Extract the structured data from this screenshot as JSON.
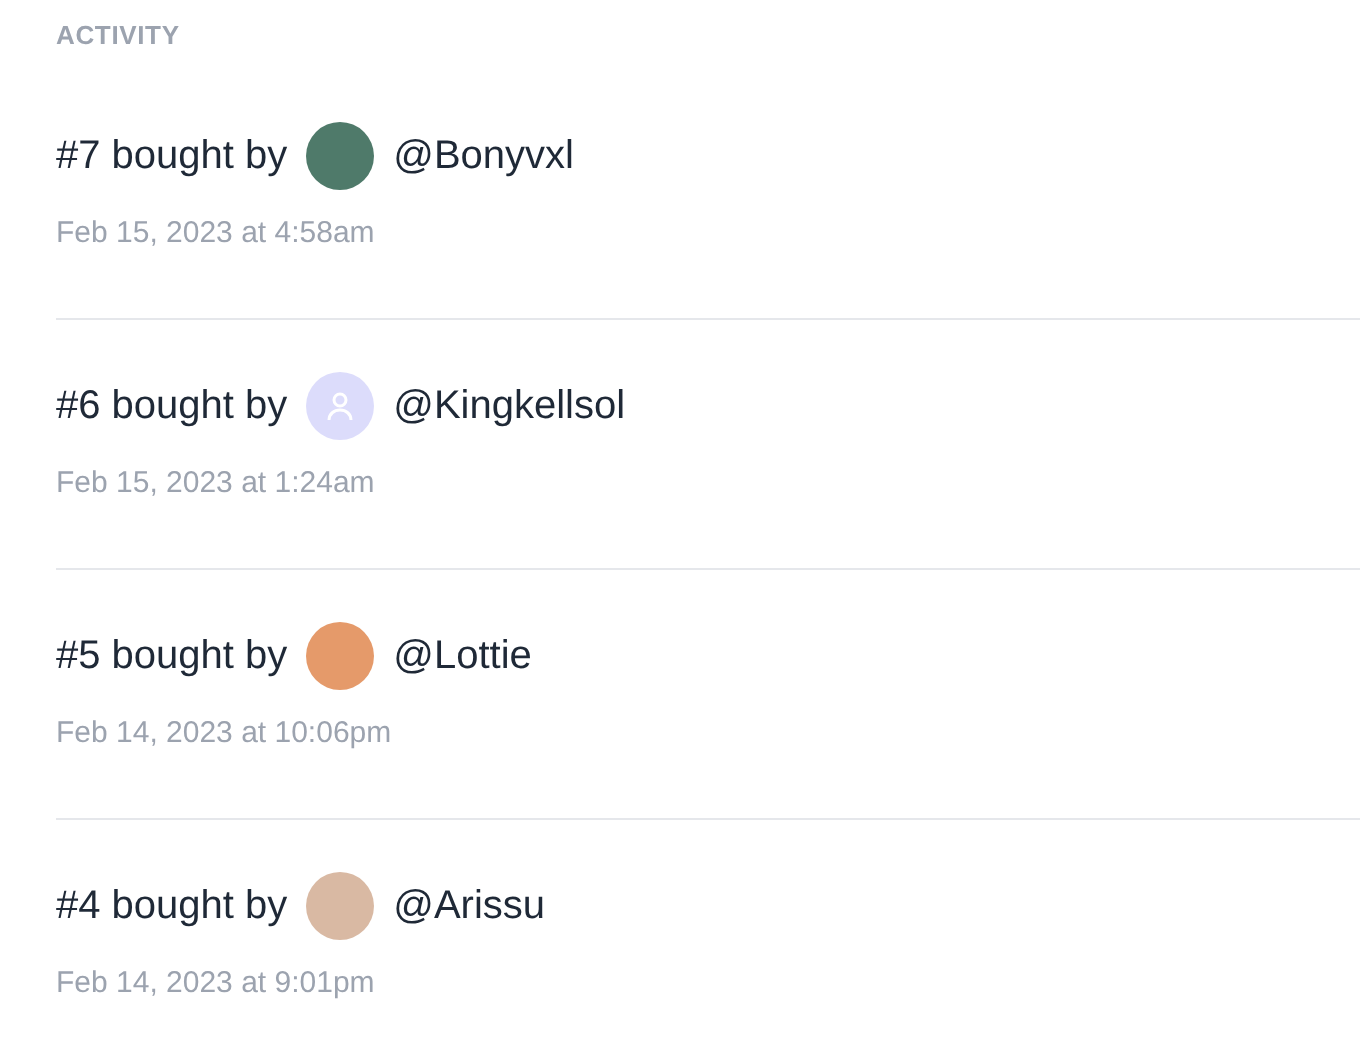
{
  "section_title": "ACTIVITY",
  "activities": [
    {
      "title": "#7 bought by",
      "avatar": {
        "kind": "picture",
        "color": "#4f7a6a"
      },
      "username": "@Bonyvxl",
      "date": "Feb 15, 2023 at 4:58am"
    },
    {
      "title": "#6 bought by",
      "avatar": {
        "kind": "default"
      },
      "username": "@Kingkellsol",
      "date": "Feb 15, 2023 at 1:24am"
    },
    {
      "title": "#5 bought by",
      "avatar": {
        "kind": "picture",
        "color": "#e59a6a"
      },
      "username": "@Lottie",
      "date": "Feb 14, 2023 at 10:06pm"
    },
    {
      "title": "#4 bought by",
      "avatar": {
        "kind": "picture",
        "color": "#d9b9a3"
      },
      "username": "@Arissu",
      "date": "Feb 14, 2023 at 9:01pm"
    }
  ]
}
